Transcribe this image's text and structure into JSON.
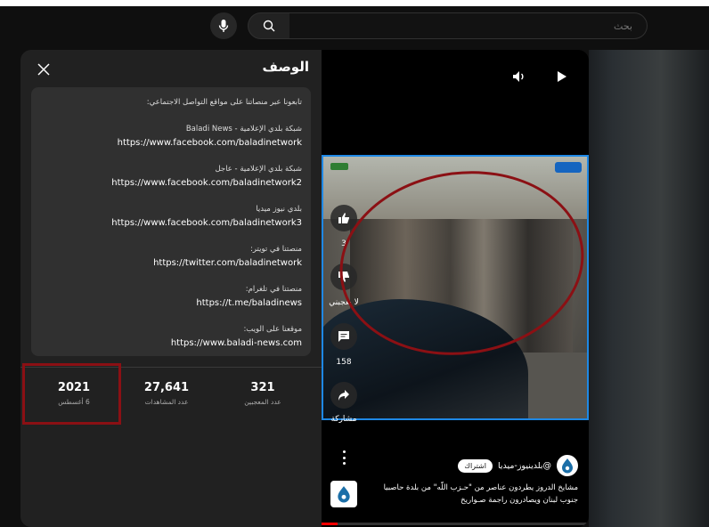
{
  "header": {
    "search_placeholder": "بحث"
  },
  "description": {
    "title": "الوصف",
    "intro": "تابعونا عبر منصاتنا على مواقع التواصل الاجتماعي:",
    "blocks": [
      {
        "label": "شبكة بلدي الإعلامية - Baladi News",
        "link": "https://www.facebook.com/baladinetwork"
      },
      {
        "label": "شبكة بلدي الإعلامية - عاجل",
        "link": "https://www.facebook.com/baladinetwork2"
      },
      {
        "label": "بلدي نيوز ميديا",
        "link": "https://www.facebook.com/baladinetwork3"
      },
      {
        "label": "منصتنا في تويتر:",
        "link": "https://twitter.com/baladinetwork"
      },
      {
        "label": "منصتنا في تلغرام:",
        "link": "https://t.me/baladinews"
      },
      {
        "label": "موقعنا على الويب:",
        "link": "https://www.baladi-news.com"
      }
    ],
    "stats": [
      {
        "num": "2021",
        "cap": "6 أغسطس"
      },
      {
        "num": "27,641",
        "cap": "عدد المشاهدات"
      },
      {
        "num": "321",
        "cap": "عدد المعجبين"
      }
    ]
  },
  "video": {
    "likes_count": "3",
    "dislike_label": "لا يعجبني",
    "comments_count": "158",
    "share_label": "مشاركة",
    "channel_name": "@بلدينيوز-ميديا",
    "subscribe_label": "اشتراك",
    "title_line1": "مشايخ الدروز يطردون عناصر من \"حـزب اللّه\" من بلدة حاصبيا",
    "title_line2": "جنوب لبنان ويصادرون راجمة صـواريخ",
    "progress": 0.06
  }
}
